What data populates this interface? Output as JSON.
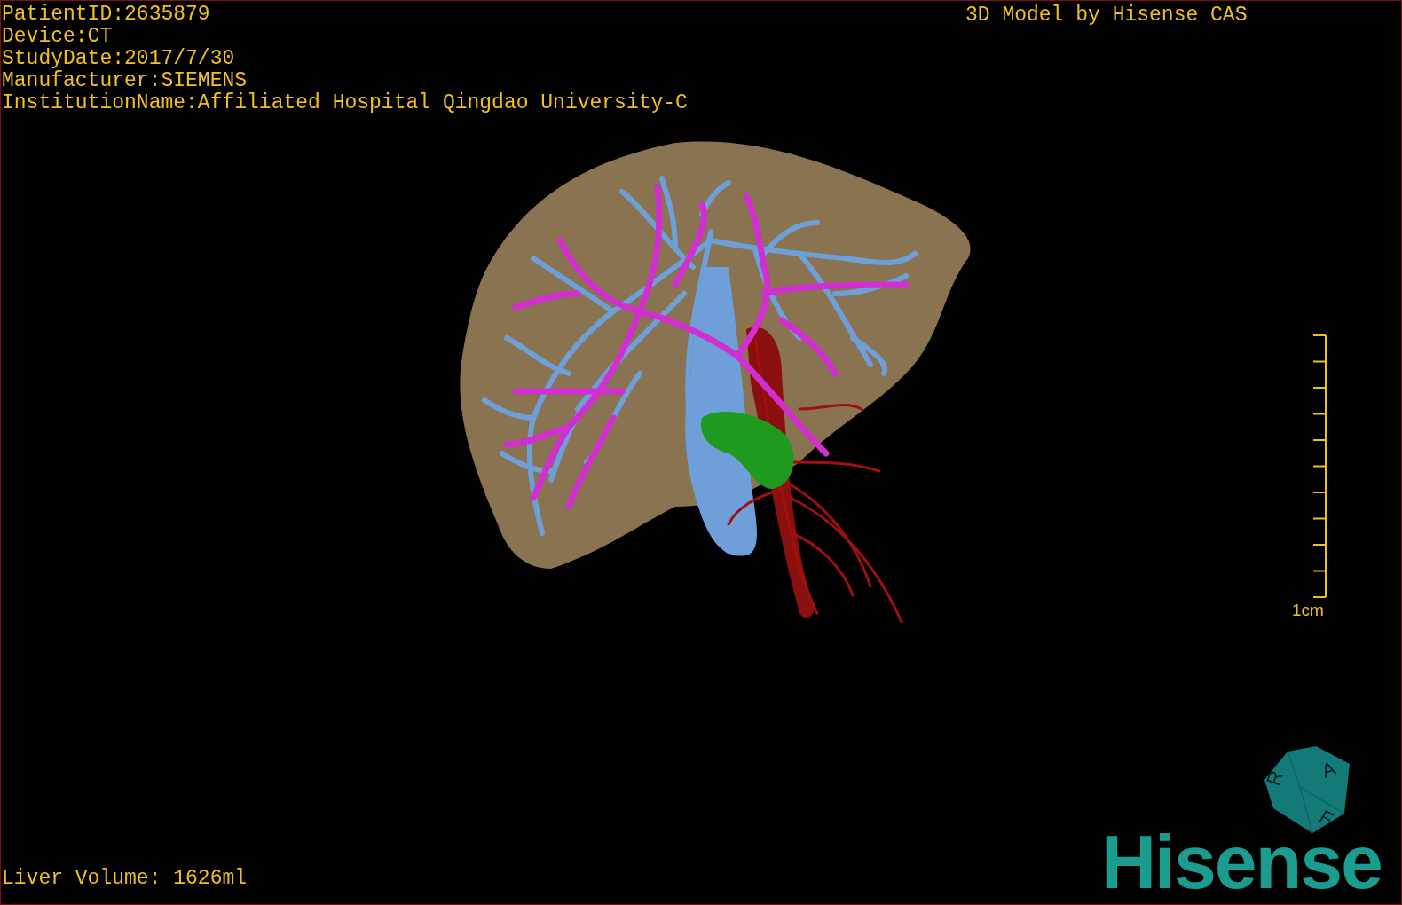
{
  "info": {
    "lines": [
      "PatientID:2635879",
      "Device:CT",
      "StudyDate:2017/7/30",
      "Manufacturer:SIEMENS",
      "InstitutionName:Affiliated Hospital Qingdao University-C"
    ]
  },
  "credit": "3D Model by Hisense CAS",
  "scale_bar": {
    "label": "1cm"
  },
  "orientation_cube": {
    "labels": [
      "R",
      "A",
      "F"
    ]
  },
  "logo": "Hisense",
  "volume": "Liver Volume: 1626ml"
}
